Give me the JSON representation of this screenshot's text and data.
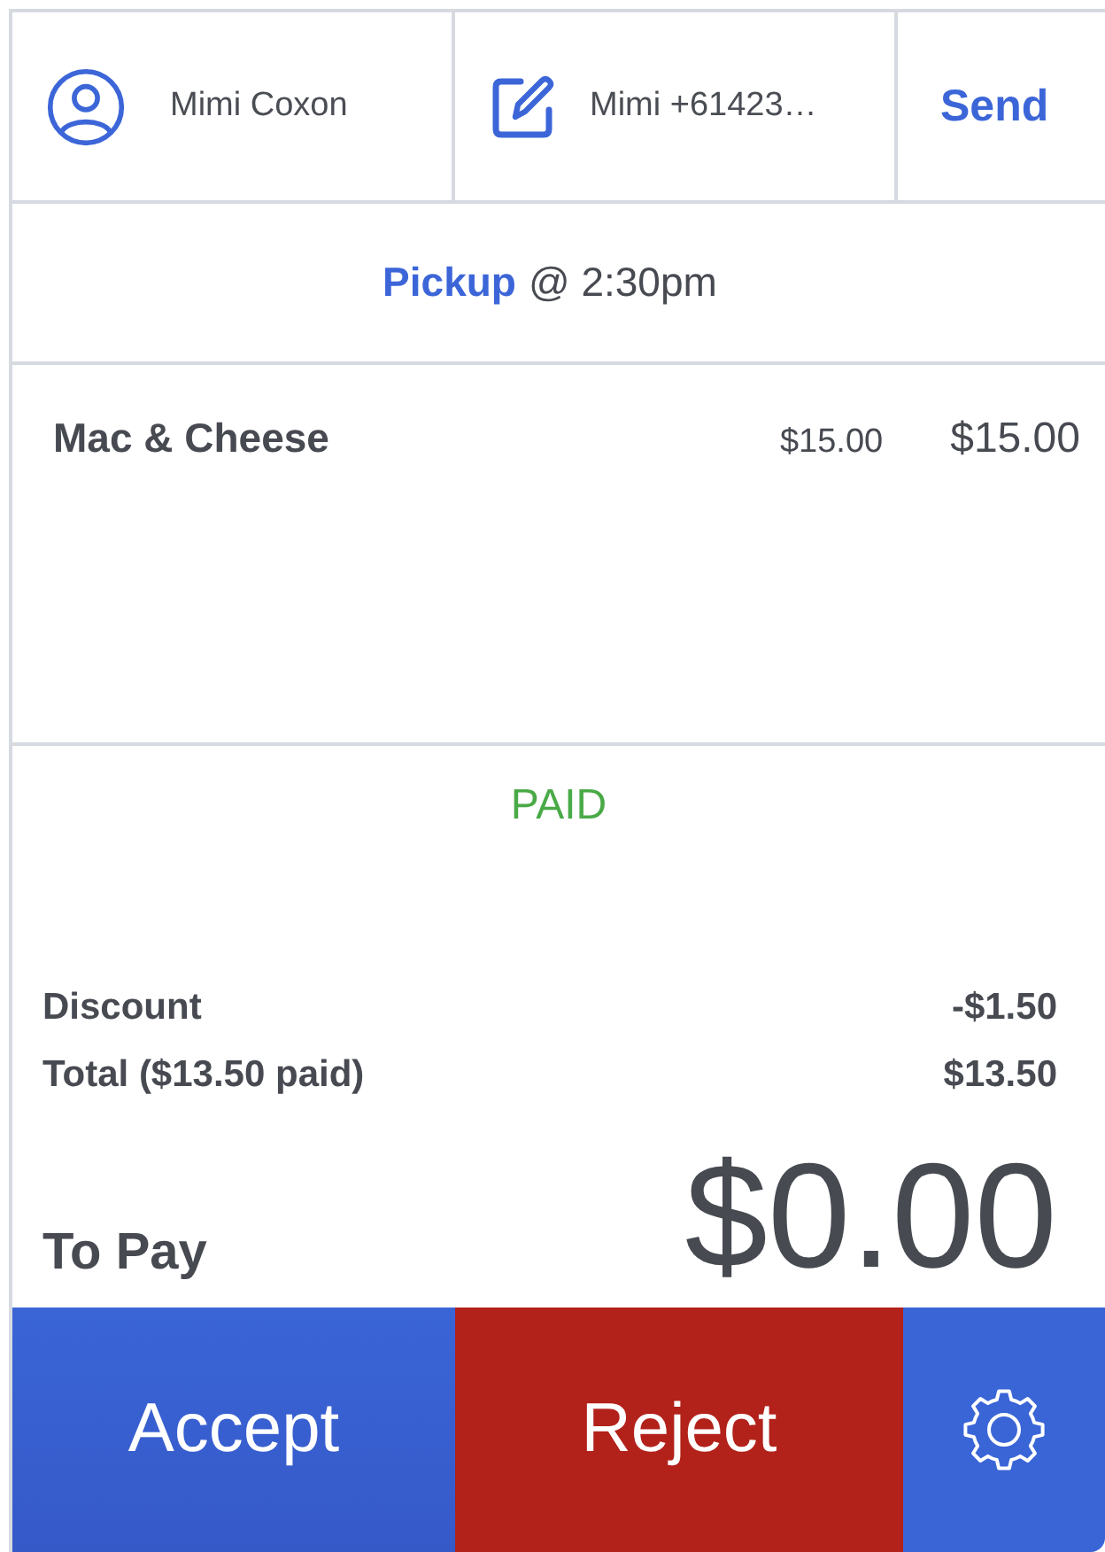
{
  "header": {
    "customer": {
      "name": "Mimi Coxon"
    },
    "message": {
      "preview": "Mimi +61423…"
    },
    "send_button": {
      "label": "Send"
    }
  },
  "fulfillment": {
    "method": "Pickup",
    "time": "@ 2:30pm"
  },
  "items": [
    {
      "name": "Mac & Cheese",
      "unit_price": "$15.00",
      "total": "$15.00"
    }
  ],
  "payment_status": {
    "label": "PAID"
  },
  "summary": [
    {
      "label": "Discount",
      "value": "-$1.50"
    },
    {
      "label": "Total ($13.50 paid)",
      "value": "$13.50"
    }
  ],
  "to_pay": {
    "label": "To Pay",
    "amount": "$0.00"
  },
  "actions": [
    {
      "kind": "accept",
      "label": "Accept"
    },
    {
      "kind": "reject",
      "label": "Reject"
    },
    {
      "kind": "settings"
    }
  ]
}
